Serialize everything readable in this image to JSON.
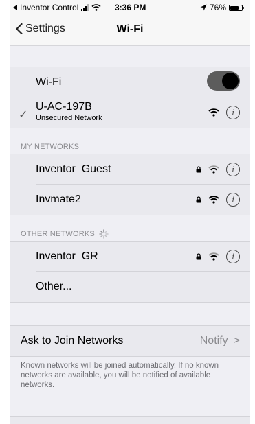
{
  "status_bar": {
    "back_app": "Inventor Control",
    "time": "3:36 PM",
    "battery": "76%",
    "battery_level": 0.76,
    "icons": [
      "back-arrow-icon",
      "cellular-signal-icon",
      "wifi-icon",
      "location-arrow-icon",
      "battery-icon"
    ]
  },
  "nav": {
    "back_label": "Settings",
    "title": "Wi-Fi"
  },
  "wifi_toggle": {
    "label": "Wi-Fi",
    "on": true
  },
  "connected": {
    "name": "U-AC-197B",
    "subtitle": "Unsecured Network",
    "checkmark": "✓"
  },
  "my_networks": {
    "header": "MY NETWORKS",
    "items": [
      {
        "name": "Inventor_Guest",
        "locked": true,
        "signal": "weak"
      },
      {
        "name": "Invmate2",
        "locked": true,
        "signal": "strong"
      }
    ]
  },
  "other_networks": {
    "header": "OTHER NETWORKS",
    "items": [
      {
        "name": "Inventor_GR",
        "locked": true,
        "signal": "weak"
      },
      {
        "name": "Other..."
      }
    ]
  },
  "ask_to_join": {
    "label": "Ask to Join Networks",
    "value": "Notify",
    "chevron": ">",
    "footer": "Known networks will be joined automatically. If no known networks are available, you will be notified of available networks."
  },
  "info_glyph": "i",
  "colors": {
    "toggle_track": "#5c5c5c",
    "background": "#efeff4",
    "cell": "#e9e9ee"
  }
}
